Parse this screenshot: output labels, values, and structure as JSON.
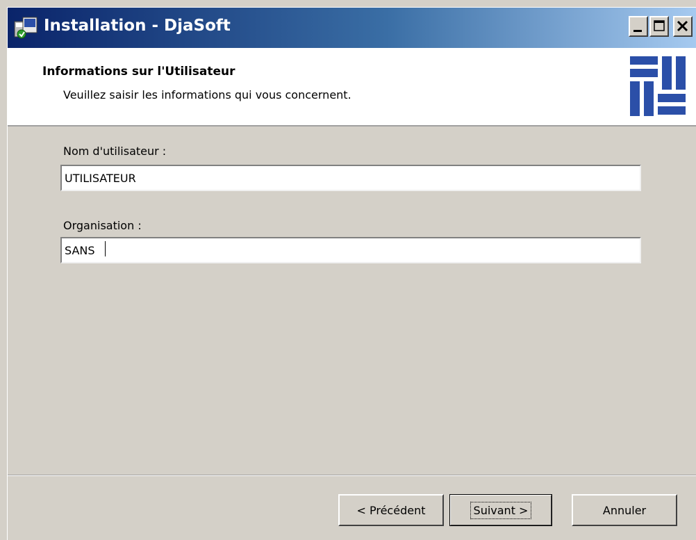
{
  "window": {
    "title": "Installation - DjaSoft"
  },
  "header": {
    "title": "Informations sur l'Utilisateur",
    "subtitle": "Veuillez saisir les informations qui vous concernent."
  },
  "form": {
    "username_label": "Nom d'utilisateur :",
    "username_value": "UTILISATEUR",
    "organisation_label": "Organisation :",
    "organisation_value": "SANS"
  },
  "buttons": {
    "previous": "< Précédent",
    "next": "Suivant >",
    "cancel": "Annuler"
  },
  "colors": {
    "titlebar_start": "#0a246a",
    "titlebar_end": "#a6caf0",
    "face": "#d4d0c8",
    "logo_blue": "#2b4fa8"
  }
}
